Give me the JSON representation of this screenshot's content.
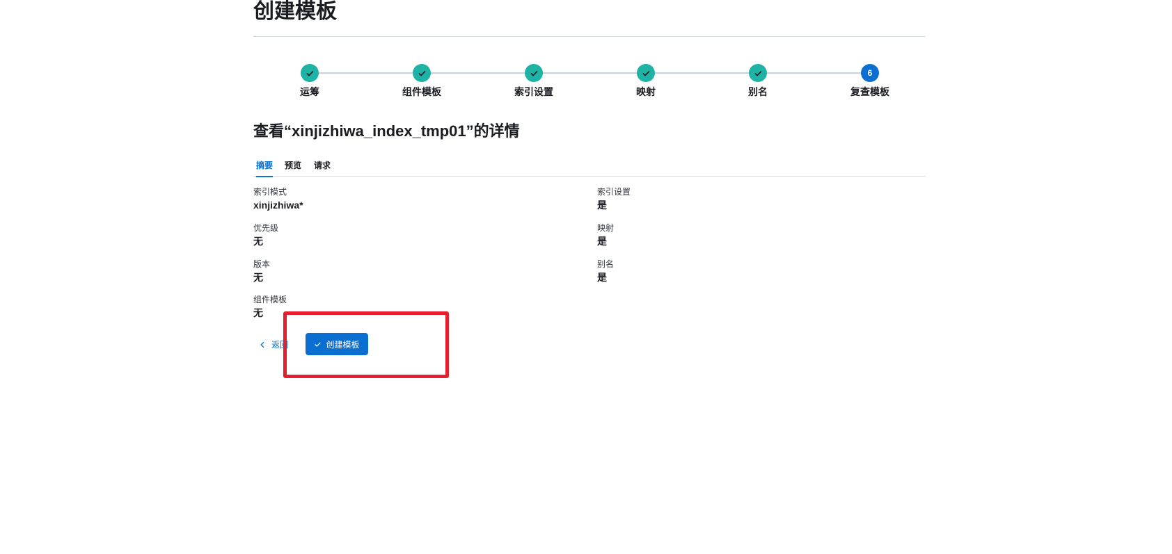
{
  "header": {
    "title": "创建模板"
  },
  "stepper": {
    "steps": [
      {
        "label": "运筹",
        "status": "complete"
      },
      {
        "label": "组件模板",
        "status": "complete"
      },
      {
        "label": "索引设置",
        "status": "complete"
      },
      {
        "label": "映射",
        "status": "complete"
      },
      {
        "label": "别名",
        "status": "complete"
      },
      {
        "label": "复查模板",
        "status": "current",
        "number": "6"
      }
    ]
  },
  "review": {
    "heading": "查看“xinjizhiwa_index_tmp01”的详情",
    "tabs": [
      {
        "label": "摘要",
        "active": true
      },
      {
        "label": "预览",
        "active": false
      },
      {
        "label": "请求",
        "active": false
      }
    ],
    "left_fields": [
      {
        "label": "索引模式",
        "value": "xinjizhiwa*"
      },
      {
        "label": "优先级",
        "value": "无"
      },
      {
        "label": "版本",
        "value": "无"
      },
      {
        "label": "组件模板",
        "value": "无"
      }
    ],
    "right_fields": [
      {
        "label": "索引设置",
        "value": "是"
      },
      {
        "label": "映射",
        "value": "是"
      },
      {
        "label": "别名",
        "value": "是"
      }
    ]
  },
  "footer": {
    "back_label": "返回",
    "create_label": "创建模板"
  },
  "colors": {
    "step_complete": "#1fb3a5",
    "step_current": "#0b6fd2",
    "primary": "#0b6fd2",
    "highlight": "#e5202e"
  }
}
